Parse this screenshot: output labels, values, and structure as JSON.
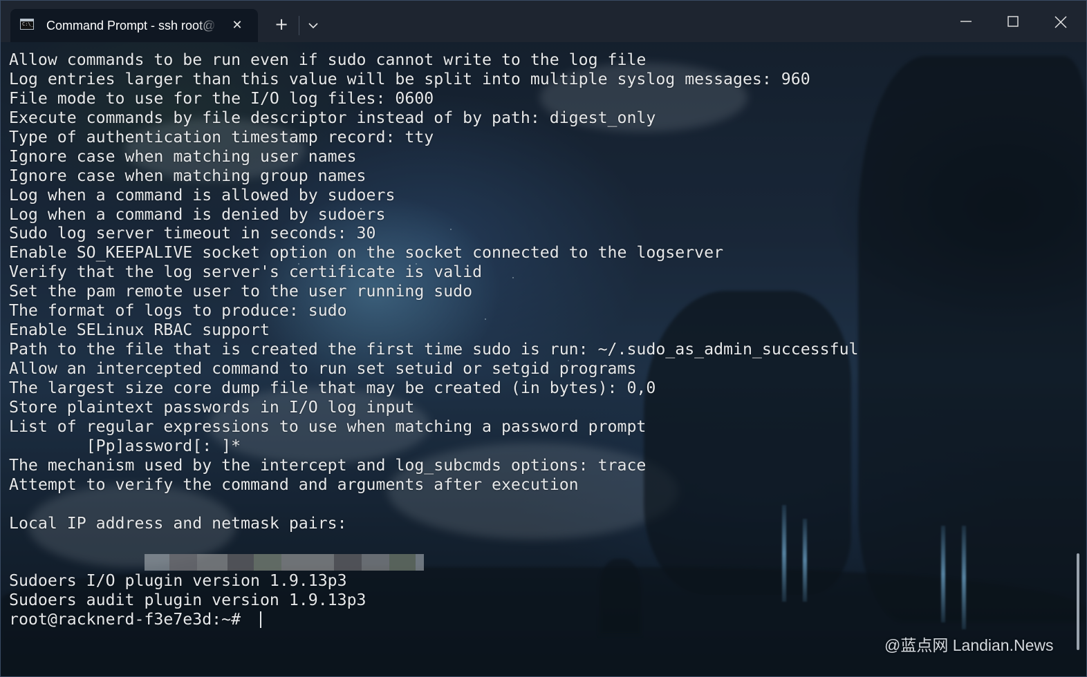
{
  "window": {
    "tab_title": "Command Prompt - ssh  root@",
    "tab_icon": "command-prompt-icon",
    "tab_icon_glyph": "C:\\_",
    "newtab_glyph": "+",
    "close_tab_glyph": "✕"
  },
  "terminal": {
    "lines": [
      "Allow commands to be run even if sudo cannot write to the log file",
      "Log entries larger than this value will be split into multiple syslog messages: 960",
      "File mode to use for the I/O log files: 0600",
      "Execute commands by file descriptor instead of by path: digest_only",
      "Type of authentication timestamp record: tty",
      "Ignore case when matching user names",
      "Ignore case when matching group names",
      "Log when a command is allowed by sudoers",
      "Log when a command is denied by sudoers",
      "Sudo log server timeout in seconds: 30",
      "Enable SO_KEEPALIVE socket option on the socket connected to the logserver",
      "Verify that the log server's certificate is valid",
      "Set the pam remote user to the user running sudo",
      "The format of logs to produce: sudo",
      "Enable SELinux RBAC support",
      "Path to the file that is created the first time sudo is run: ~/.sudo_as_admin_successful",
      "Allow an intercepted command to run set setuid or setgid programs",
      "The largest size core dump file that may be created (in bytes): 0,0",
      "Store plaintext passwords in I/O log input",
      "List of regular expressions to use when matching a password prompt",
      "        [Pp]assword[: ]*",
      "The mechanism used by the intercept and log_subcmds options: trace",
      "Attempt to verify the command and arguments after execution",
      "",
      "Local IP address and netmask pairs:"
    ],
    "lines_after": [
      "",
      "Sudoers I/O plugin version 1.9.13p3",
      "Sudoers audit plugin version 1.9.13p3"
    ],
    "prompt": "root@racknerd-f3e7e3d:~# "
  },
  "watermark": "@蓝点网 Landian.News",
  "colors": {
    "text": "#e6e8ea",
    "titlebar": "#1e2530",
    "tab_active": "#0f1722"
  }
}
